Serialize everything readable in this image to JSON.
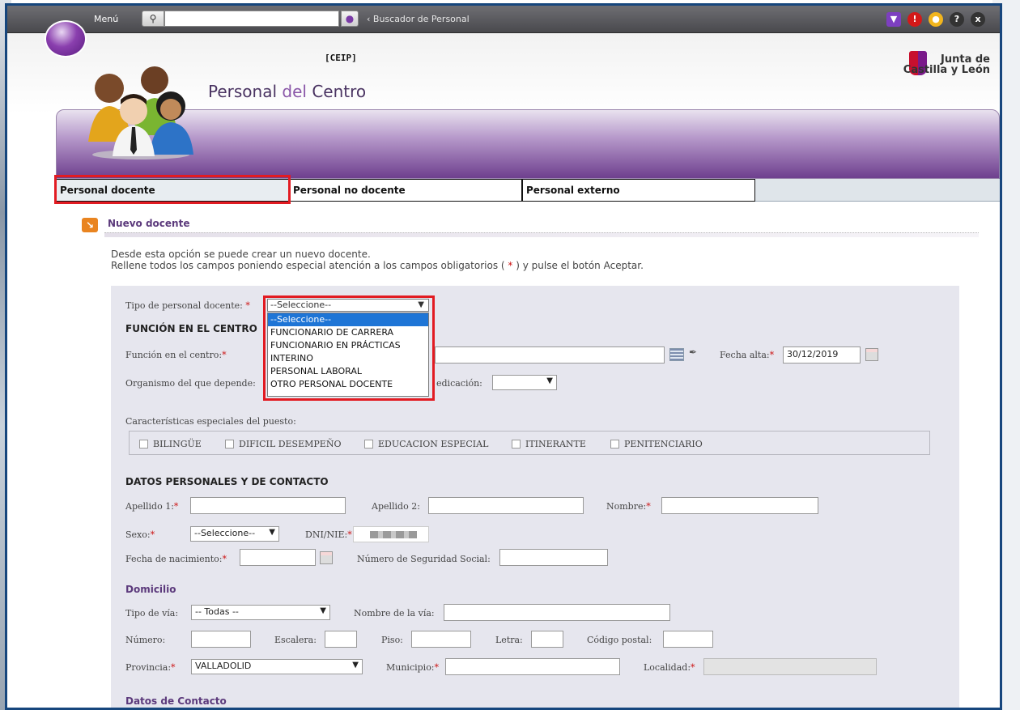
{
  "topbar": {
    "menu_label": "Menú",
    "search_value": "",
    "breadcrumb": "‹ Buscador de Personal",
    "icon_colors": {
      "download": "#7d3fc0",
      "alert": "#d31919",
      "idea": "#f2b51d",
      "help": "#333333",
      "close": "#333333"
    }
  },
  "header": {
    "center_type": "[CEIP]",
    "title_part1": "Personal",
    "title_part2": " del ",
    "title_part3": "Centro",
    "org_line1": "Junta de",
    "org_line2": "Castilla y León"
  },
  "tabs": [
    {
      "label": "Personal docente"
    },
    {
      "label": "Personal no docente"
    },
    {
      "label": "Personal externo"
    }
  ],
  "section": {
    "title": "Nuevo docente",
    "intro_line1": "Desde esta opción se puede crear un nuevo docente.",
    "intro_line2_a": "Rellene todos los campos poniendo especial atención a los campos obligatorios (",
    "intro_line2_b": "*",
    "intro_line2_c": ") y pulse el botón Aceptar."
  },
  "form": {
    "tipo_label": "Tipo de personal docente:",
    "tipo_selected": "--Seleccione--",
    "tipo_options": [
      "--Seleccione--",
      "FUNCIONARIO DE CARRERA",
      "FUNCIONARIO EN PRÁCTICAS",
      "INTERINO",
      "PERSONAL LABORAL",
      "OTRO PERSONAL DOCENTE"
    ],
    "funcion_header": "FUNCIÓN EN EL CENTRO",
    "funcion_label": "Función en el centro:",
    "fecha_alta_label": "Fecha alta:",
    "fecha_alta_value": "30/12/2019",
    "organismo_label": "Organismo del que depende:",
    "dedicacion_label": "edicación:",
    "dedicacion_value": "",
    "caracteristicas_label": "Características especiales del puesto:",
    "checkboxes": [
      "BILINGÜE",
      "DIFICIL DESEMPEÑO",
      "EDUCACION ESPECIAL",
      "ITINERANTE",
      "PENITENCIARIO"
    ],
    "personales_header": "DATOS PERSONALES Y DE CONTACTO",
    "apellido1_label": "Apellido 1:",
    "apellido2_label": "Apellido 2:",
    "nombre_label": "Nombre:",
    "sexo_label": "Sexo:",
    "sexo_value": "--Seleccione--",
    "dni_label": "DNI/NIE:",
    "nacimiento_label": "Fecha de nacimiento:",
    "nss_label": "Número de Seguridad Social:",
    "domicilio_header": "Domicilio",
    "tipo_via_label": "Tipo de vía:",
    "tipo_via_value": "-- Todas --",
    "nombre_via_label": "Nombre de la vía:",
    "numero_label": "Número:",
    "escalera_label": "Escalera:",
    "piso_label": "Piso:",
    "letra_label": "Letra:",
    "cp_label": "Código postal:",
    "provincia_label": "Provincia:",
    "provincia_value": "VALLADOLID",
    "municipio_label": "Municipio:",
    "localidad_label": "Localidad:",
    "contacto_header": "Datos de Contacto",
    "required_mark": "*"
  }
}
